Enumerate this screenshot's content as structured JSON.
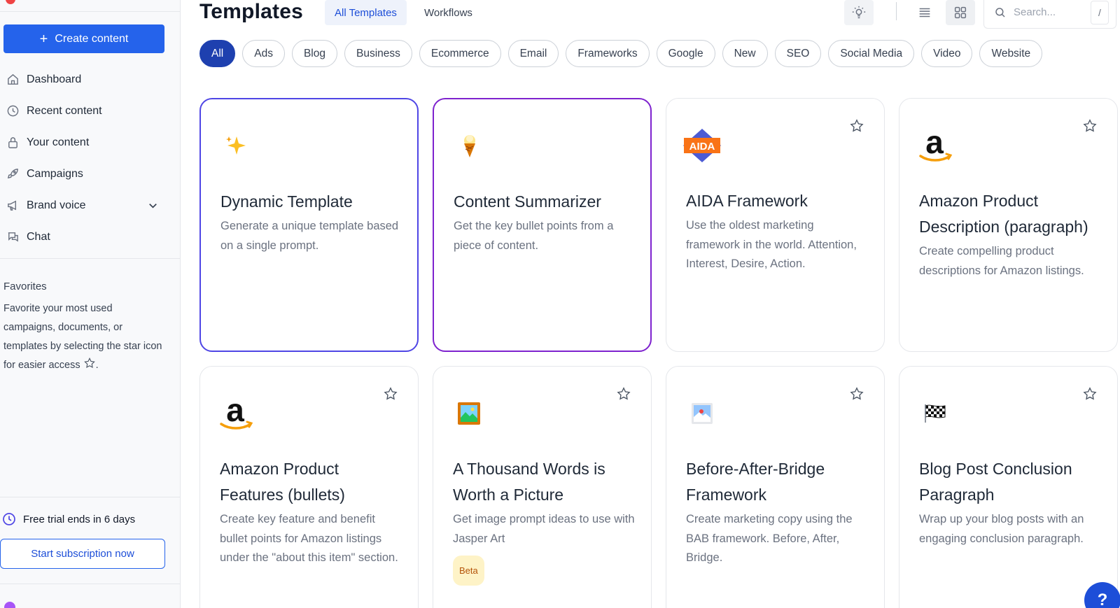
{
  "sidebar": {
    "create_label": "Create content",
    "nav": [
      {
        "label": "Dashboard",
        "icon": "home-icon"
      },
      {
        "label": "Recent content",
        "icon": "clock-icon"
      },
      {
        "label": "Your content",
        "icon": "lock-icon"
      },
      {
        "label": "Campaigns",
        "icon": "rocket-icon"
      },
      {
        "label": "Brand voice",
        "icon": "megaphone-icon"
      },
      {
        "label": "Chat",
        "icon": "chat-icon"
      }
    ],
    "favorites_title": "Favorites",
    "favorites_desc": "Favorite your most used campaigns, documents, or templates by selecting the star icon for easier access",
    "favorites_desc_end": ".",
    "trial_text": "Free trial ends in 6 days",
    "subscribe_label": "Start subscription now"
  },
  "header": {
    "title": "Templates",
    "tabs": [
      {
        "label": "All Templates",
        "active": true
      },
      {
        "label": "Workflows",
        "active": false
      }
    ],
    "search_placeholder": "Search...",
    "search_shortcut": "/"
  },
  "filters": [
    "All",
    "Ads",
    "Blog",
    "Business",
    "Ecommerce",
    "Email",
    "Frameworks",
    "Google",
    "New",
    "SEO",
    "Social Media",
    "Video",
    "Website"
  ],
  "active_filter": "All",
  "cards": [
    {
      "title": "Dynamic Template",
      "desc": "Generate a unique template based on a single prompt.",
      "icon": "sparkles-icon"
    },
    {
      "title": "Content Summarizer",
      "desc": "Get the key bullet points from a piece of content.",
      "icon": "ice-cream-icon"
    },
    {
      "title": "AIDA Framework",
      "desc": "Use the oldest marketing framework in the world. Attention, Interest, Desire, Action.",
      "icon": "aida-logo-icon",
      "icon_text": "AIDA"
    },
    {
      "title": "Amazon Product Description (paragraph)",
      "desc": "Create compelling product descriptions for Amazon listings.",
      "icon": "amazon-logo-icon"
    },
    {
      "title": "Amazon Product Features (bullets)",
      "desc": "Create key feature and benefit bullet points for Amazon listings under the \"about this item\" section.",
      "icon": "amazon-logo-icon"
    },
    {
      "title": "A Thousand Words is Worth a Picture",
      "desc": "Get image prompt ideas to use with Jasper Art",
      "icon": "framed-picture-icon",
      "badge": "Beta"
    },
    {
      "title": "Before-After-Bridge Framework",
      "desc": "Create marketing copy using the BAB framework. Before, After, Bridge.",
      "icon": "picture-icon"
    },
    {
      "title": "Blog Post Conclusion Paragraph",
      "desc": "Wrap up your blog posts with an engaging conclusion paragraph.",
      "icon": "checkered-flag-icon"
    }
  ],
  "help_label": "?",
  "colors": {
    "primary": "#2563eb",
    "active_chip": "#1e40af",
    "selected_card_blue": "#4f46e5",
    "selected_card_purple": "#7e22ce"
  }
}
